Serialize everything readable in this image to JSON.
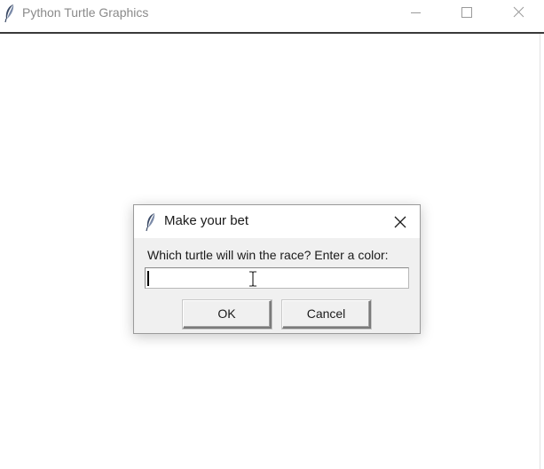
{
  "window": {
    "title": "Python Turtle Graphics",
    "icons": {
      "app": "feather-icon",
      "minimize": "minimize-icon",
      "maximize": "maximize-icon",
      "close": "close-icon"
    }
  },
  "dialog": {
    "title": "Make your bet",
    "prompt": "Which turtle will win the race? Enter a color:",
    "input_value": "",
    "ok_label": "OK",
    "cancel_label": "Cancel",
    "icons": {
      "app": "feather-icon",
      "close": "close-icon"
    }
  },
  "colors": {
    "titlebar_text": "#8a8a8a",
    "dialog_background": "#f0f0f0",
    "canvas_background": "#ffffff"
  }
}
